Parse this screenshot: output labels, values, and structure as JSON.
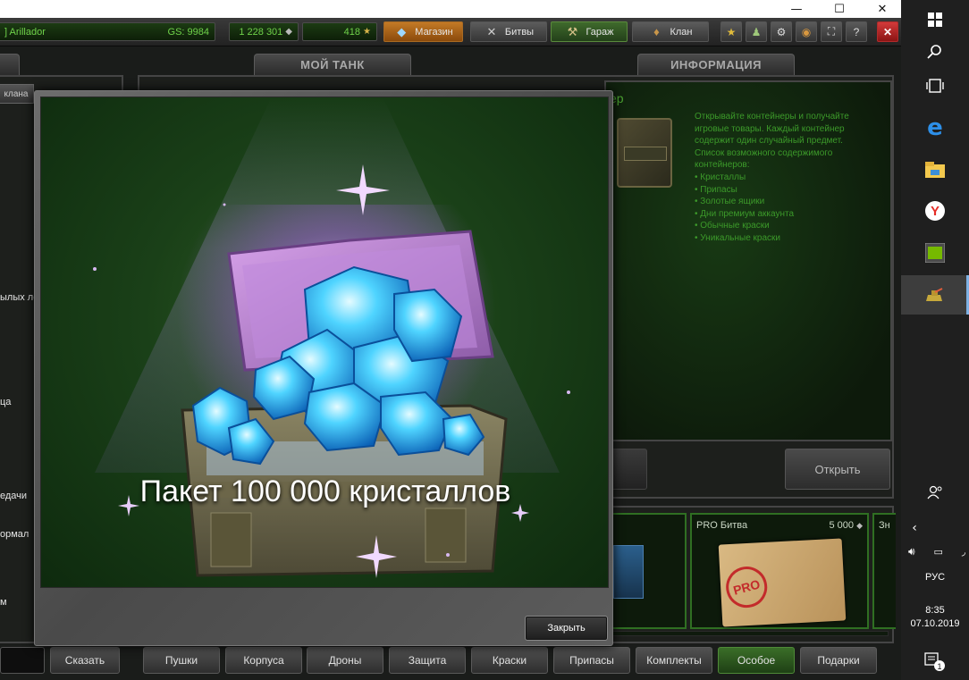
{
  "window": {
    "minimize_glyph": "—",
    "maximize_glyph": "☐",
    "close_glyph": "✕"
  },
  "topbar": {
    "player_name": "] Arillador",
    "gs_label": "GS: 9984",
    "crystals": "1 228 301",
    "stars": "418",
    "shop_label": "Магазин",
    "battles_label": "Битвы",
    "garage_label": "Гараж",
    "clan_label": "Клан",
    "icons": [
      "star-icon",
      "friends-icon",
      "settings-icon",
      "sound-icon",
      "fullscreen-icon",
      "help-icon",
      "close-icon"
    ]
  },
  "tabs": {
    "my_tank": "МОЙ ТАНК",
    "info": "ИНФОРМАЦИЯ",
    "left_tab_fragment": "клана"
  },
  "left_panel": {
    "fragments": [
      "ылых лет,",
      "ца",
      "едачи",
      "ормал",
      "м"
    ]
  },
  "info": {
    "title_fragment": "ер",
    "description_lines": [
      "Открывайте контейнеры и получайте",
      "игровые товары. Каждый контейнер",
      "содержит один случайный предмет.",
      "Список возможного содержимого",
      "контейнеров:",
      "• Кристаллы",
      "• Припасы",
      "• Золотые ящики",
      "• Дни премиум аккаунта",
      "• Обычные краски",
      "• Уникальные краски"
    ],
    "open_button": "Открыть"
  },
  "cards": [
    {
      "title": "PRO Битва",
      "price": "5 000",
      "stamp": "PRO"
    },
    {
      "title_fragment": "Зн"
    },
    {
      "title_fragment": "о"
    }
  ],
  "progress": {
    "fraction": 0.23
  },
  "bottom": {
    "say_button": "Сказать",
    "categories": [
      "Пушки",
      "Корпуса",
      "Дроны",
      "Защита",
      "Краски",
      "Припасы",
      "Комплекты",
      "Особое",
      "Подарки"
    ],
    "active_category": "Особое"
  },
  "modal": {
    "caption": "Пакет 100 000 кристаллов",
    "close_button": "Закрыть"
  },
  "taskbar": {
    "language": "РУС",
    "time": "8:35",
    "date": "07.10.2019",
    "notification_count": "1",
    "icons": [
      "windows-start-icon",
      "search-icon",
      "task-view-icon",
      "edge-icon",
      "file-explorer-icon",
      "yandex-browser-icon",
      "nvidia-icon",
      "tanki-online-icon"
    ],
    "accent": "#7fb2e5"
  },
  "colors": {
    "accent_green": "#4ea833",
    "shop_orange": "#c37a26",
    "close_red": "#d23a3a"
  }
}
